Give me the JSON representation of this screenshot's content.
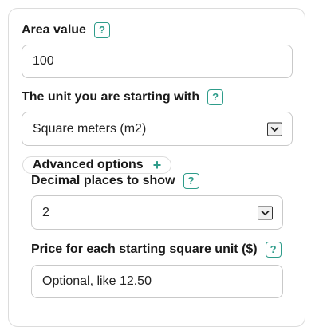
{
  "area": {
    "label": "Area value",
    "help": "?",
    "value": "100"
  },
  "unit": {
    "label": "The unit you are starting with",
    "help": "?",
    "selected": "Square meters (m2)"
  },
  "advanced": {
    "label": "Advanced options",
    "toggle_symbol": "+"
  },
  "decimals": {
    "label": "Decimal places to show",
    "help": "?",
    "selected": "2"
  },
  "price": {
    "label": "Price for each starting square unit ($)",
    "help": "?",
    "placeholder": "Optional, like 12.50"
  },
  "colors": {
    "accent": "#2e9c8a",
    "border": "#c9c9c9"
  }
}
